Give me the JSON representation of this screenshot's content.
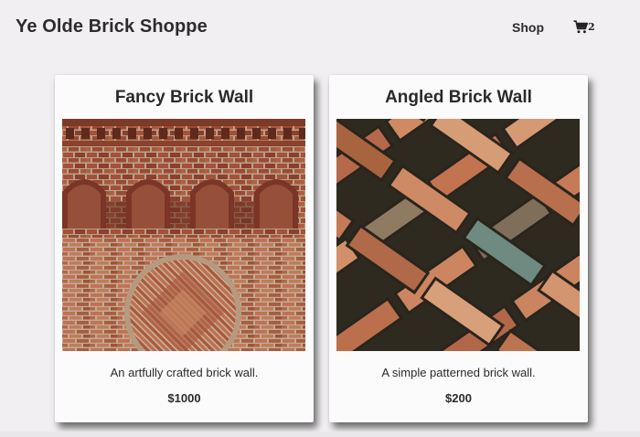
{
  "header": {
    "brand": "Ye Olde Brick Shoppe",
    "nav_shop": "Shop",
    "cart_icon": "shopping-cart-icon",
    "cart_count": "2"
  },
  "products": [
    {
      "title": "Fancy Brick Wall",
      "description": "An artfully crafted brick wall.",
      "price": "$1000",
      "image": "fancy-brick-wall-photo"
    },
    {
      "title": "Angled Brick Wall",
      "description": "A simple patterned brick wall.",
      "price": "$200",
      "image": "herringbone-brick-photo"
    }
  ],
  "colors": {
    "background": "#f1eff1",
    "card": "#fbfbfb",
    "text": "#2a2a2a",
    "brick_red": "#9b4a33",
    "mortar": "#b8a48f"
  }
}
